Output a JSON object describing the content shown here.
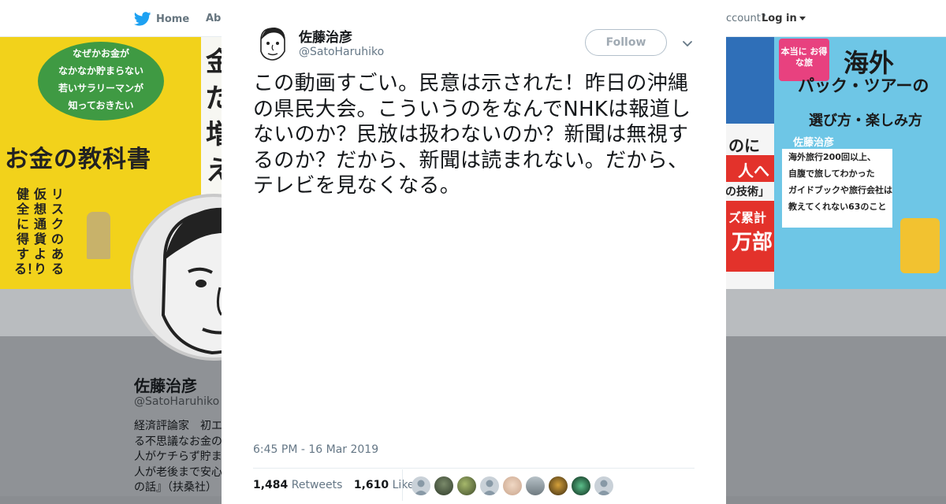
{
  "nav": {
    "home_label": "Home",
    "about_label": "Abo",
    "account_prompt": "ccount?",
    "login_label": "Log in"
  },
  "banner": {
    "left_book": {
      "top_lines": [
        "なぜかお金が",
        "なかなか貯まらない",
        "若いサラリーマンが",
        "知っておきたい"
      ],
      "title": "お金の教科書",
      "vertical_lines": [
        "リスクのある",
        "仮想通貨より",
        "健全に得する！"
      ]
    },
    "middle_book_chars": [
      "金",
      "だ",
      "増",
      "え"
    ],
    "red_book": {
      "line1": "のに",
      "line2": "人へ",
      "line3": "の技術」",
      "line4": "ズ累計",
      "line5": "万部"
    },
    "blue_book": {
      "badge": "本当に お得な旅",
      "title": "海外",
      "subtitle": "パック・ツアーの",
      "subtitle2": "選び方・楽しみ方",
      "author": "佐藤治彦",
      "box_lines": [
        "海外旅行200回以上、",
        "自腹で旅してわかった",
        "ガイドブックや旅行会社は",
        "教えてくれない63のこと"
      ]
    }
  },
  "profile": {
    "name": "佐藤治彦",
    "handle": "@SatoHaruhiko",
    "bio_lines": [
      "経済評論家　初エ",
      "る不思議なお金の",
      "人がケチらず貯ま",
      "人が老後まで安心",
      "の話』（扶桑社）"
    ]
  },
  "tweet": {
    "author_name": "佐藤治彦",
    "author_handle": "@SatoHaruhiko",
    "follow_label": "Follow",
    "text": "この動画すごい。民意は示された！昨日の沖縄の県民大会。こういうのをなんでNHKは報道しないのか？民放は扱わないのか？新聞は無視するのか？だから、新聞は読まれない。だから、テレビを見なくなる。",
    "timestamp": "6:45 PM - 16 Mar 2019",
    "retweets_count": "1,484",
    "retweets_label": "Retweets",
    "likes_count": "1,610",
    "likes_label": "Likes"
  },
  "colors": {
    "twitter_blue": "#1da1f2",
    "text_primary": "#14171a",
    "text_secondary": "#657786",
    "overlay": "#8a8d91"
  },
  "icons": {
    "nav_home": "twitter-bird-icon",
    "close": "close-icon",
    "dropdown": "chevron-down-icon"
  }
}
